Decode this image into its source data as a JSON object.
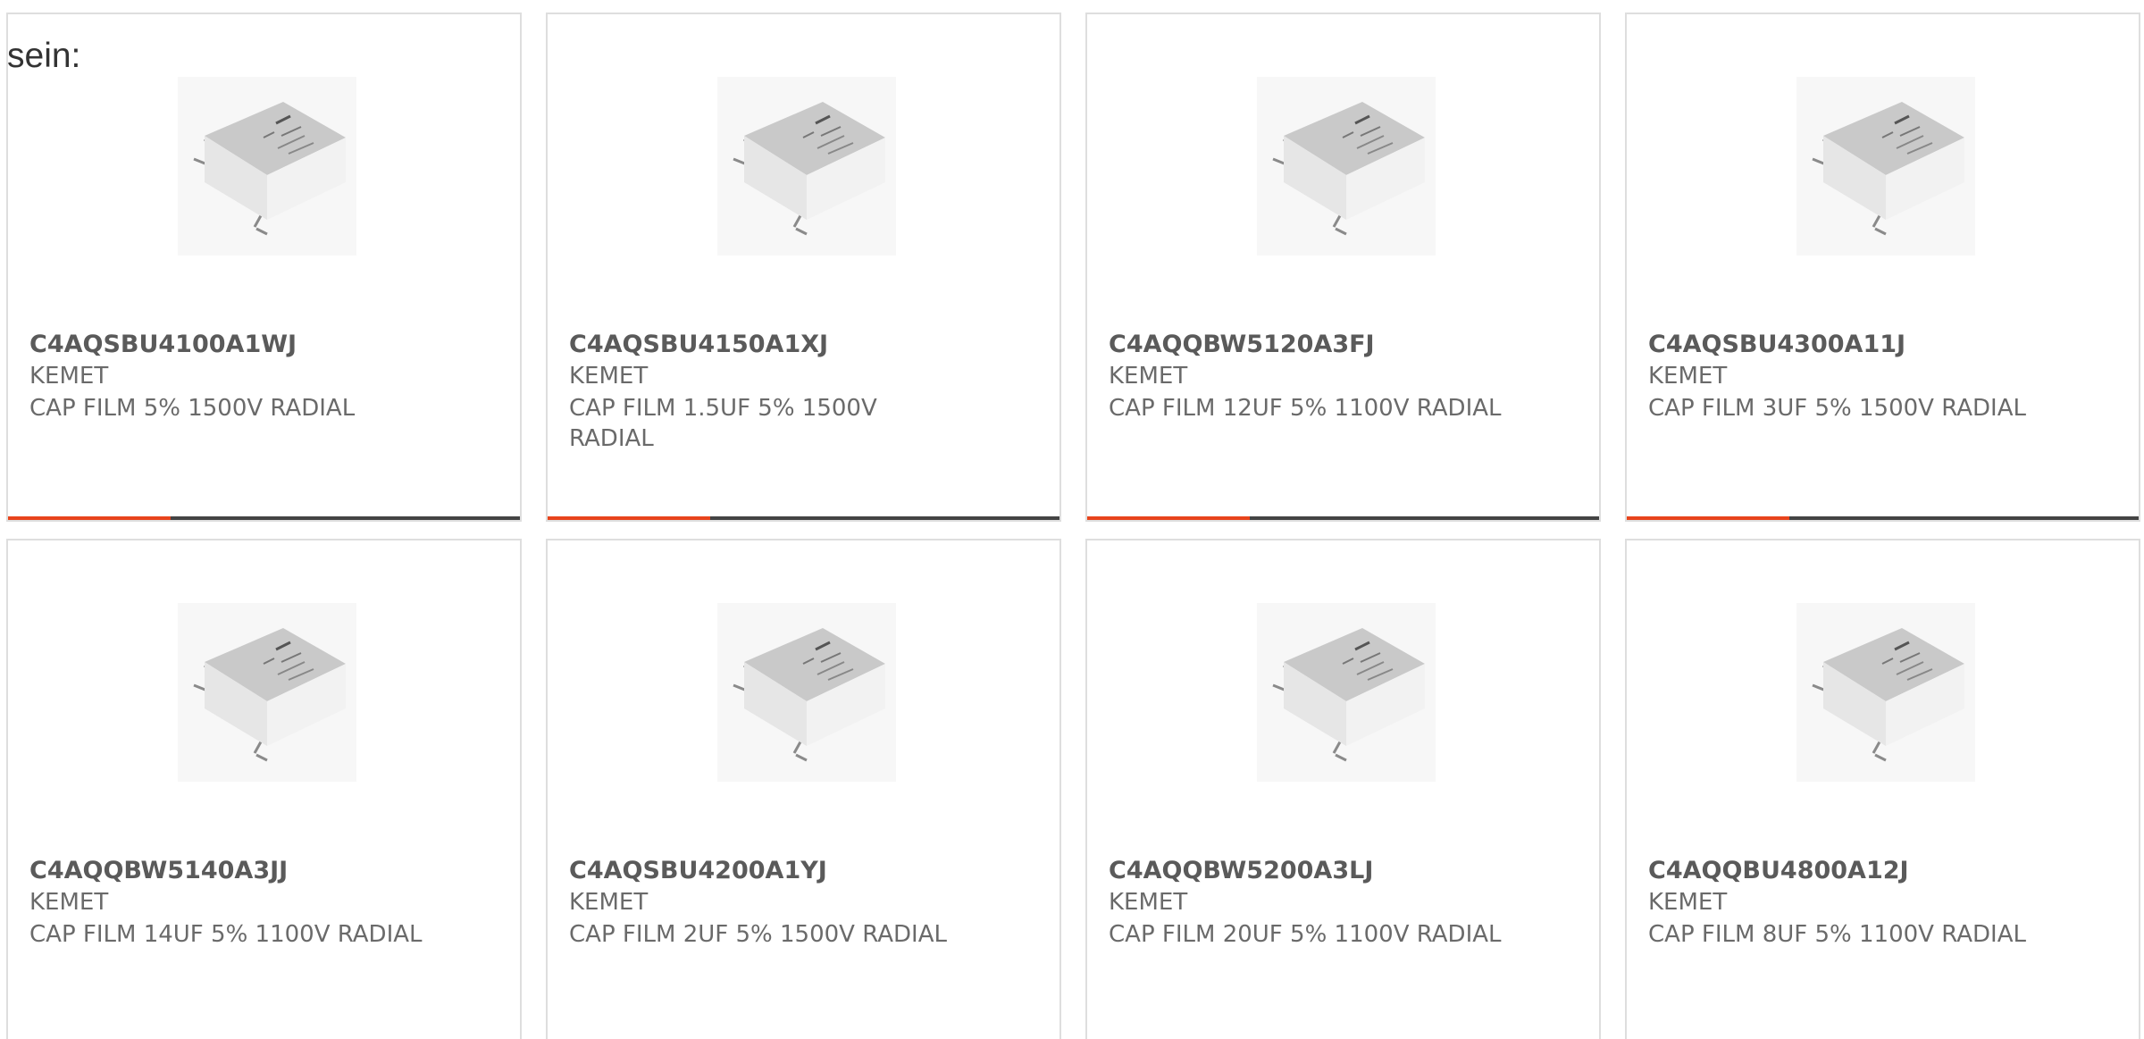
{
  "intro_text": "sein:",
  "colors": {
    "accent": "#e8441c",
    "bar": "#444444",
    "border": "#dedede",
    "text": "#5f5f5f"
  },
  "product_image_icon": "capacitor-image",
  "products": [
    {
      "part": "C4AQSBU4100A1WJ",
      "maker": "KEMET",
      "desc": "CAP FILM 5% 1500V RADIAL"
    },
    {
      "part": "C4AQSBU4150A1XJ",
      "maker": "KEMET",
      "desc": "CAP FILM 1.5UF 5% 1500V RADIAL"
    },
    {
      "part": "C4AQQBW5120A3FJ",
      "maker": "KEMET",
      "desc": "CAP FILM 12UF 5% 1100V RADIAL"
    },
    {
      "part": "C4AQSBU4300A11J",
      "maker": "KEMET",
      "desc": "CAP FILM 3UF 5% 1500V RADIAL"
    },
    {
      "part": "C4AQQBW5140A3JJ",
      "maker": "KEMET",
      "desc": "CAP FILM 14UF 5% 1100V RADIAL"
    },
    {
      "part": "C4AQSBU4200A1YJ",
      "maker": "KEMET",
      "desc": "CAP FILM 2UF 5% 1500V RADIAL"
    },
    {
      "part": "C4AQQBW5200A3LJ",
      "maker": "KEMET",
      "desc": "CAP FILM 20UF 5% 1100V RADIAL"
    },
    {
      "part": "C4AQQBU4800A12J",
      "maker": "KEMET",
      "desc": "CAP FILM 8UF 5% 1100V RADIAL"
    }
  ]
}
